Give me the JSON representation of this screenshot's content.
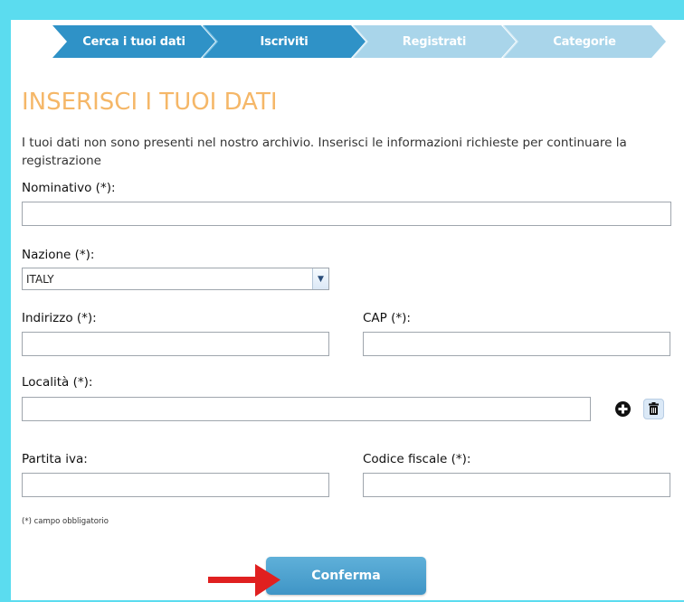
{
  "steps": [
    {
      "label": "Cerca i tuoi dati",
      "state": "done",
      "color": "#2f92c7"
    },
    {
      "label": "Iscriviti",
      "state": "active",
      "color": "#2f92c7"
    },
    {
      "label": "Registrati",
      "state": "pending",
      "color": "#a9d5ea"
    },
    {
      "label": "Categorie",
      "state": "pending",
      "color": "#a9d5ea"
    }
  ],
  "title": "INSERISCI I TUOI DATI",
  "intro": "I tuoi dati non sono presenti nel nostro archivio. Inserisci le informazioni richieste per continuare la registrazione",
  "fields": {
    "nominativo": {
      "label": "Nominativo (*):",
      "value": ""
    },
    "nazione": {
      "label": "Nazione (*):",
      "value": "ITALY"
    },
    "indirizzo": {
      "label": "Indirizzo (*):",
      "value": ""
    },
    "cap": {
      "label": "CAP (*):",
      "value": ""
    },
    "localita": {
      "label": "Località (*):",
      "value": ""
    },
    "partita_iva": {
      "label": "Partita iva:",
      "value": ""
    },
    "codice_fiscale": {
      "label": "Codice fiscale (*):",
      "value": ""
    }
  },
  "localita_actions": {
    "add_icon": "plus-circle-icon",
    "delete_icon": "trash-icon"
  },
  "note": "(*) campo obbligatorio",
  "confirm_label": "Conferma",
  "colors": {
    "background": "#5bdcef",
    "title": "#f5b768",
    "step_active": "#2f92c7",
    "step_pending": "#a9d5ea",
    "annotation_arrow": "#e02020"
  }
}
